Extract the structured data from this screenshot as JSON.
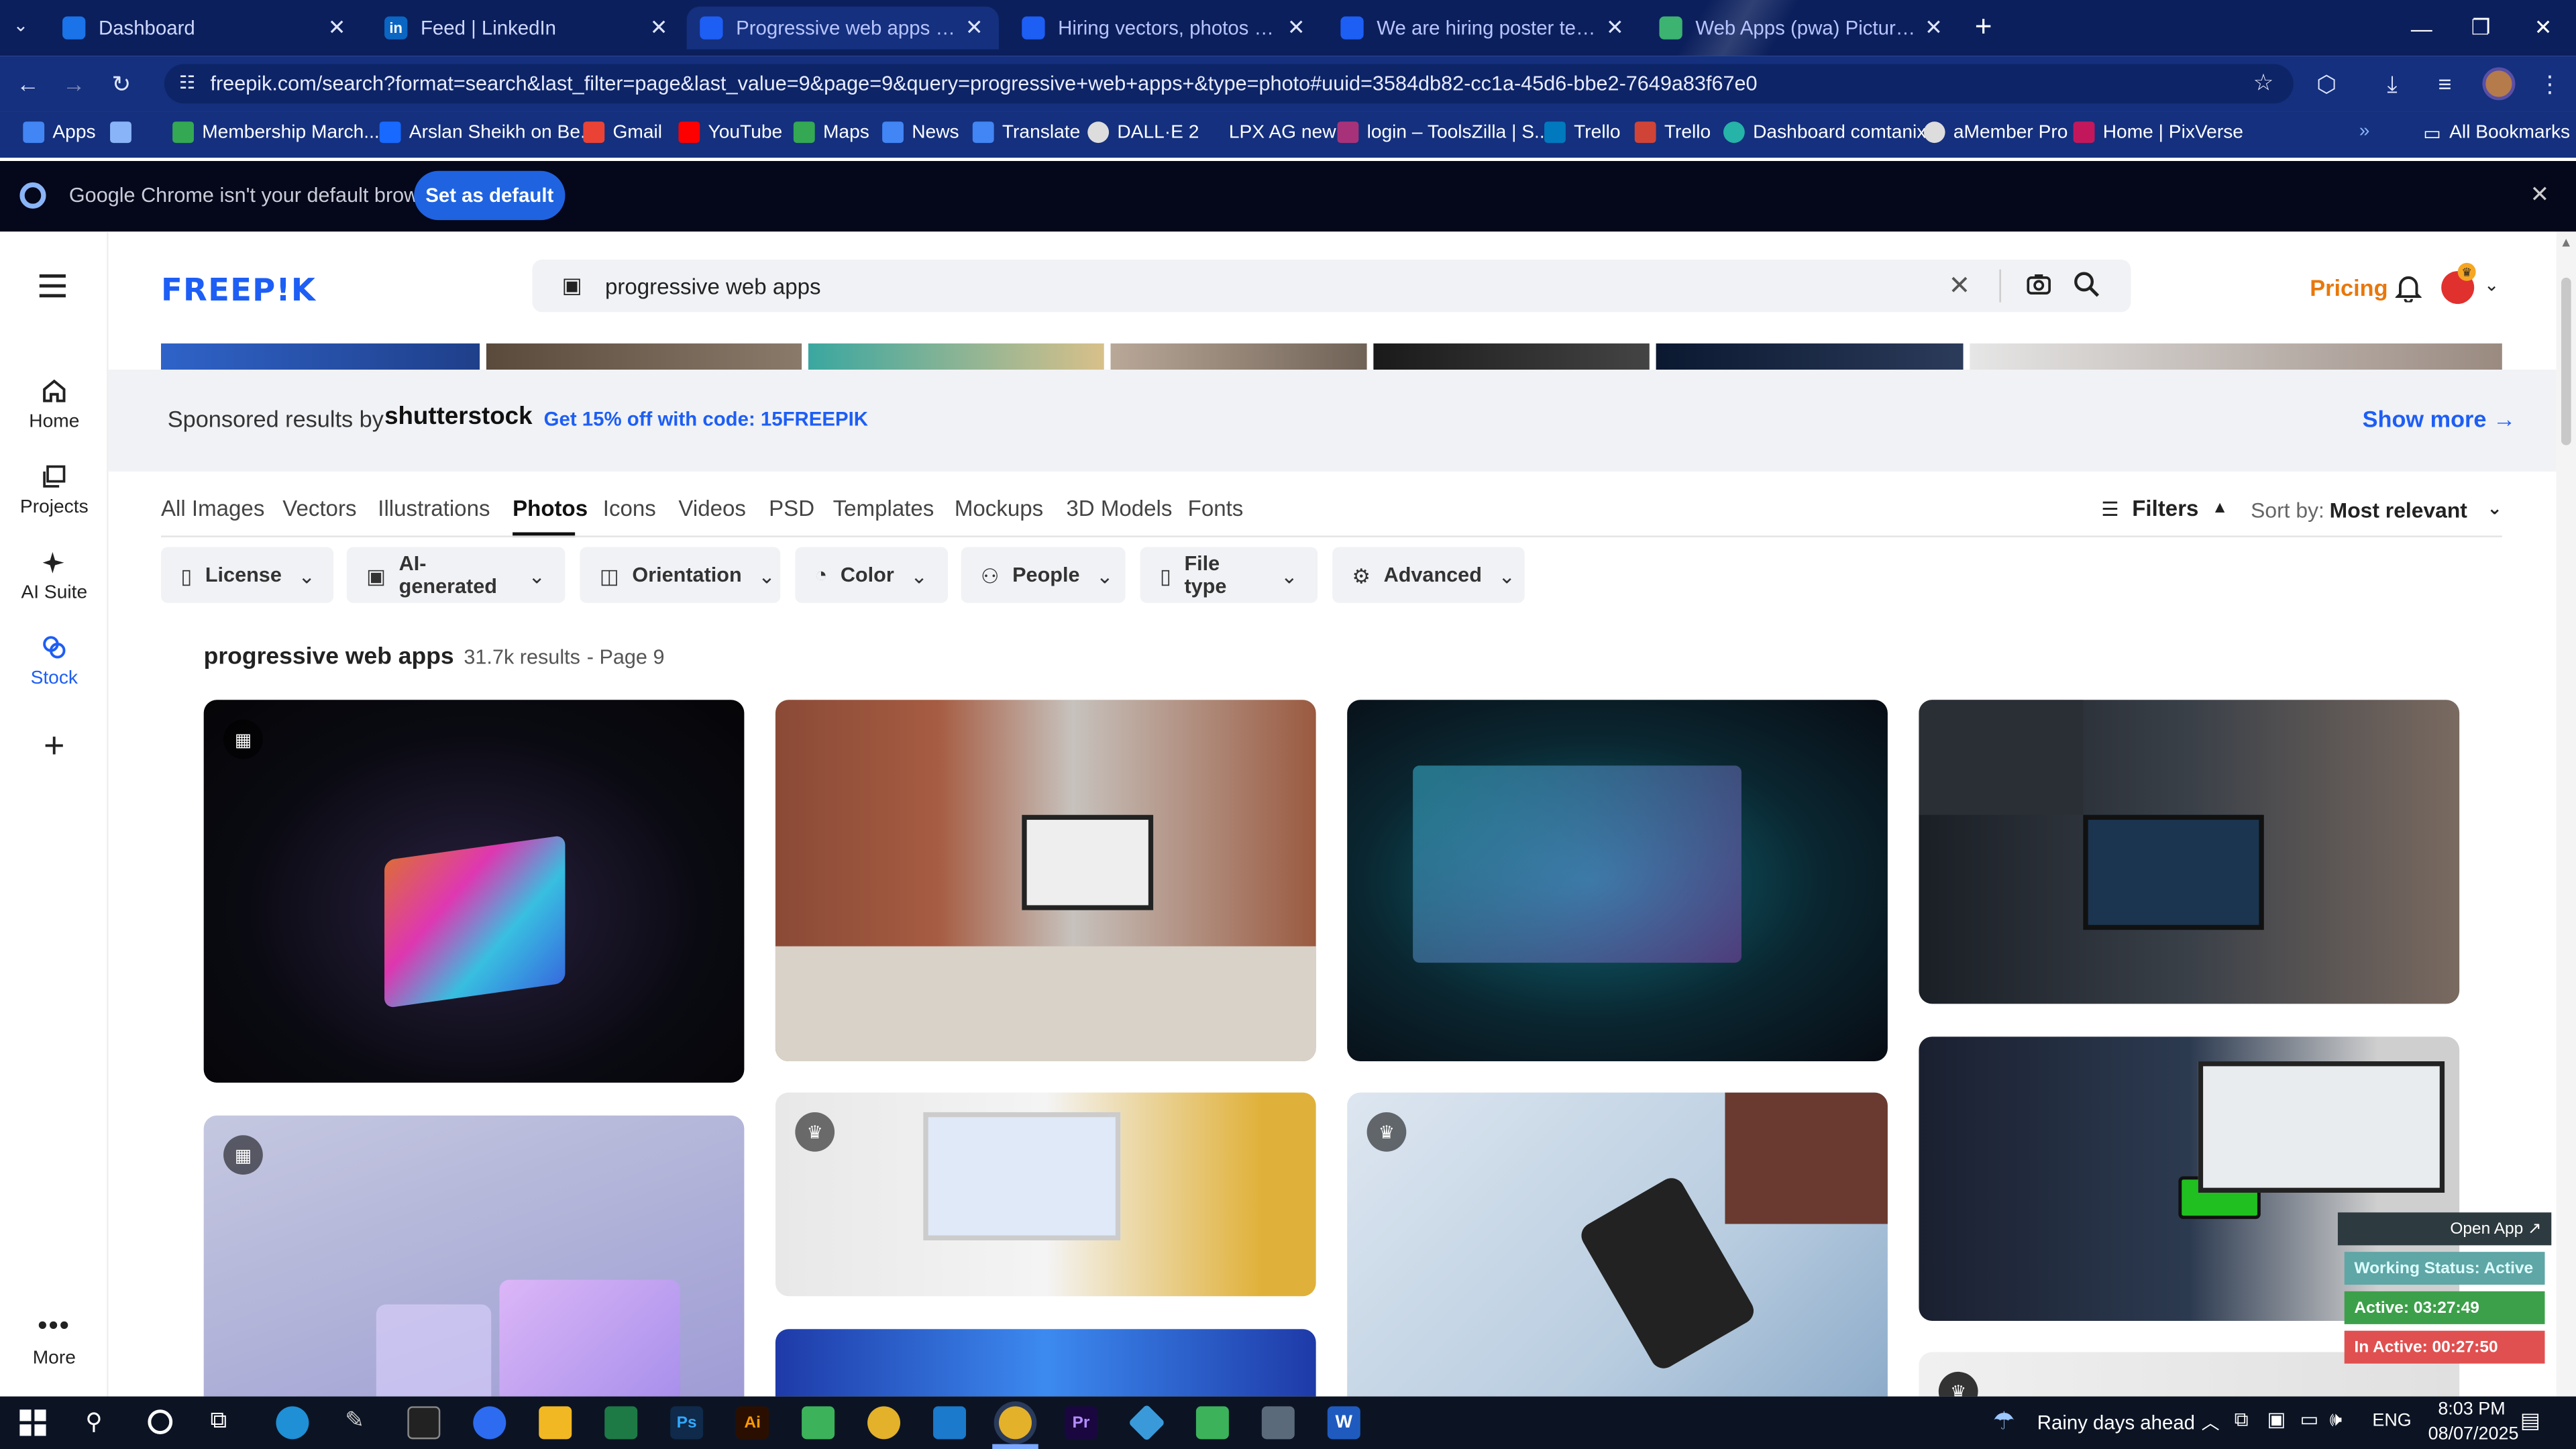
{
  "browser": {
    "tabs": [
      {
        "title": "Dashboard",
        "favicon_color": "#1a73e8"
      },
      {
        "title": "Feed | LinkedIn",
        "favicon_color": "#0a66c2"
      },
      {
        "title": "Progressive web apps Photos | ",
        "favicon_color": "#1d5ef5"
      },
      {
        "title": "Hiring vectors, photos and PSD",
        "favicon_color": "#1d5ef5"
      },
      {
        "title": "We are hiring poster template |",
        "favicon_color": "#1d5ef5"
      },
      {
        "title": "Web Apps (pwa) Pictures, Imag",
        "favicon_color": "#3cb371"
      }
    ],
    "new_tab": "+",
    "url": "freepik.com/search?format=search&last_filter=page&last_value=9&page=9&query=progressive+web+apps+&type=photo#uuid=3584db82-cc1a-45d6-bbe2-7649a83f67e0",
    "bookmarks": [
      {
        "label": "Apps",
        "color": "#4285f4"
      },
      {
        "label": "",
        "color": "#8ab4f8"
      },
      {
        "label": "Membership March...",
        "color": "#34a853"
      },
      {
        "label": "Arslan Sheikh on Be...",
        "color": "#1769ff"
      },
      {
        "label": "Gmail",
        "color": "#ea4335"
      },
      {
        "label": "YouTube",
        "color": "#ff0000"
      },
      {
        "label": "Maps",
        "color": "#34a853"
      },
      {
        "label": "News",
        "color": "#4285f4"
      },
      {
        "label": "Translate",
        "color": "#4285f4"
      },
      {
        "label": "DALL·E 2",
        "color": "#dddddd"
      },
      {
        "label": "LPX AG new",
        "color": "#14307e"
      },
      {
        "label": "login – ToolsZilla | S...",
        "color": "#a83279"
      },
      {
        "label": "Trello",
        "color": "#0079bf"
      },
      {
        "label": "Trello",
        "color": "#d04437"
      },
      {
        "label": "Dashboard comtanix",
        "color": "#26b3a8"
      },
      {
        "label": "aMember Pro",
        "color": "#dddddd"
      },
      {
        "label": "Home | PixVerse",
        "color": "#c2185b"
      }
    ],
    "bookmarks_more": "»",
    "all_bookmarks": "All Bookmarks"
  },
  "infobar": {
    "message": "Google Chrome isn't your default browser",
    "button": "Set as default"
  },
  "rail": {
    "items": [
      {
        "label": "Home"
      },
      {
        "label": "Projects"
      },
      {
        "label": "AI Suite"
      },
      {
        "label": "Stock"
      }
    ],
    "more": "More"
  },
  "header": {
    "logo": "FREEP!K",
    "search_value": "progressive web apps",
    "pricing": "Pricing"
  },
  "sponsored": {
    "label": "Sponsored results by",
    "brand": "shutterstock",
    "promo": "Get 15% off with code: 15FREEPIK",
    "show_more": "Show more →"
  },
  "categories": [
    "All Images",
    "Vectors",
    "Illustrations",
    "Photos",
    "Icons",
    "Videos",
    "PSD",
    "Templates",
    "Mockups",
    "3D Models",
    "Fonts"
  ],
  "active_category": "Photos",
  "filters_label": "Filters",
  "sort": {
    "label": "Sort by:",
    "value": "Most relevant"
  },
  "filter_buttons": [
    "License",
    "AI-generated",
    "Orientation",
    "Color",
    "People",
    "File type",
    "Advanced"
  ],
  "results": {
    "query": "progressive web apps",
    "count": "31.7k results",
    "page": "- Page 9"
  },
  "widget": {
    "open_app": "Open App ↗",
    "status": "Working Status: Active",
    "active": "Active: 03:27:49",
    "inactive": "In Active: 00:27:50"
  },
  "taskbar": {
    "weather": "Rainy days ahead",
    "lang": "ENG",
    "time": "8:03 PM",
    "date": "08/07/2025"
  }
}
